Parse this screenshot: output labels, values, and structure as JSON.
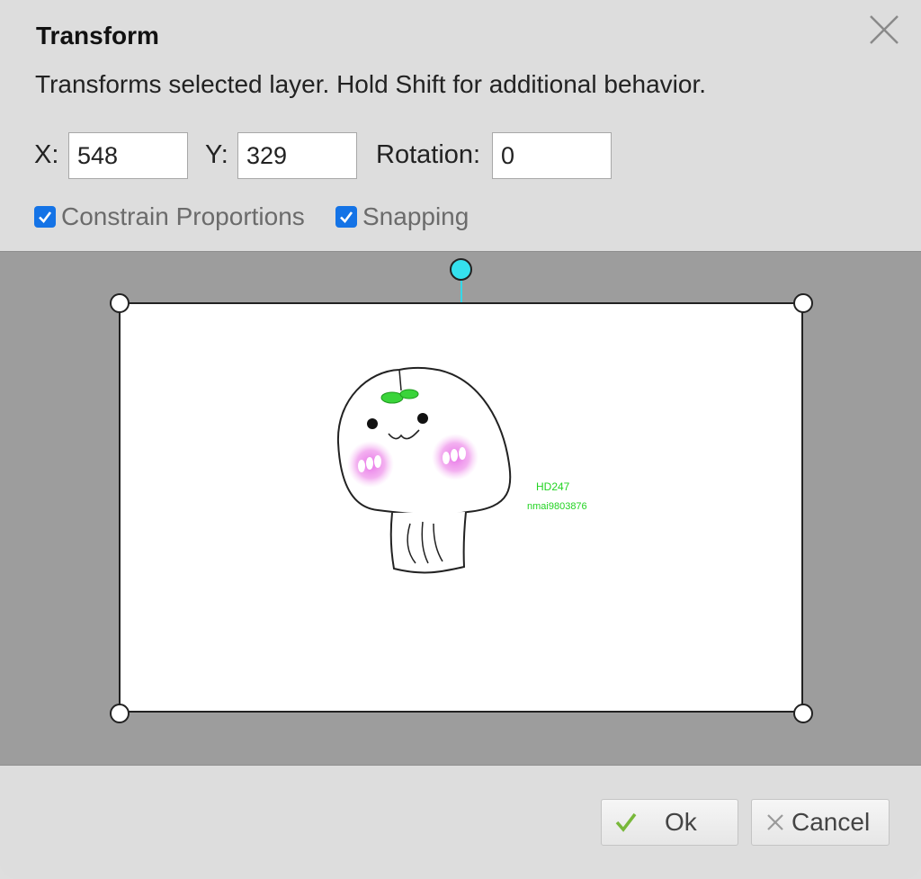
{
  "dialog": {
    "title": "Transform",
    "description": "Transforms selected layer. Hold Shift for additional behavior.",
    "close_icon": "close-icon"
  },
  "fields": {
    "x_label": "X:",
    "x_value": "548",
    "y_label": "Y:",
    "y_value": "329",
    "rotation_label": "Rotation:",
    "rotation_value": "0"
  },
  "options": {
    "constrain_label": "Constrain Proportions",
    "constrain_checked": true,
    "snapping_label": "Snapping",
    "snapping_checked": true
  },
  "canvas": {
    "layer_text_line1": "HD247",
    "layer_text_line2": "nmai9803876",
    "accent_color": "#35e1ee",
    "text_color": "#22d322"
  },
  "footer": {
    "ok_label": "Ok",
    "cancel_label": "Cancel",
    "ok_icon": "check-icon",
    "cancel_icon": "x-icon"
  }
}
